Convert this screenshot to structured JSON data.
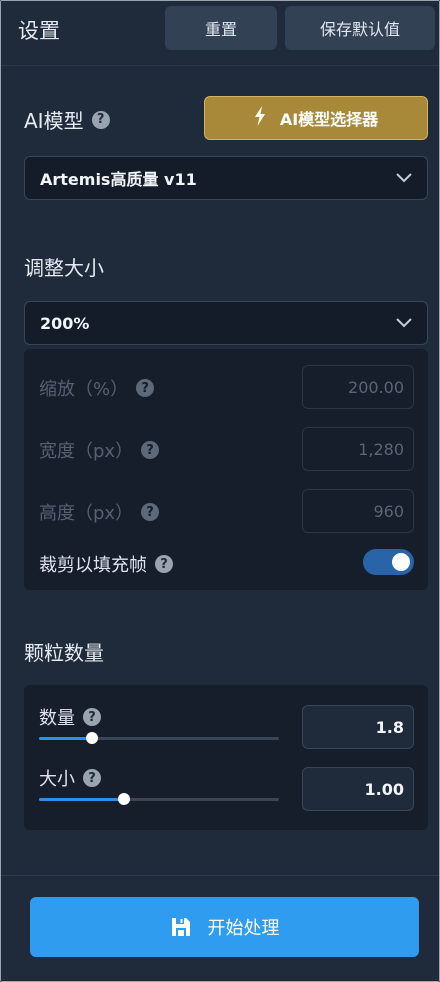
{
  "header": {
    "title": "设置",
    "reset_label": "重置",
    "save_default_label": "保存默认值"
  },
  "ai_model": {
    "heading": "AI模型",
    "picker_label": "AI模型选择器",
    "selected": "Artemis高质量 v11"
  },
  "resize": {
    "heading": "调整大小",
    "selected": "200%",
    "scale_label": "缩放（%）",
    "scale_value": "200.00",
    "width_label": "宽度（px）",
    "width_value": "1,280",
    "height_label": "高度（px）",
    "height_value": "960",
    "crop_label": "裁剪以填充帧",
    "crop_enabled": true
  },
  "grain": {
    "heading": "颗粒数量",
    "amount_label": "数量",
    "amount_value": "1.8",
    "amount_fraction": 0.22,
    "size_label": "大小",
    "size_value": "1.00",
    "size_fraction": 0.355
  },
  "footer": {
    "start_label": "开始处理"
  },
  "icons": {
    "help": "question-circle-icon",
    "bolt": "lightning-bolt-icon",
    "chevron": "chevron-down-icon",
    "save": "floppy-disk-icon"
  },
  "colors": {
    "accent": "#2f9cf0",
    "picker_gold": "#a8893a",
    "toggle_on": "#2a64a8"
  }
}
